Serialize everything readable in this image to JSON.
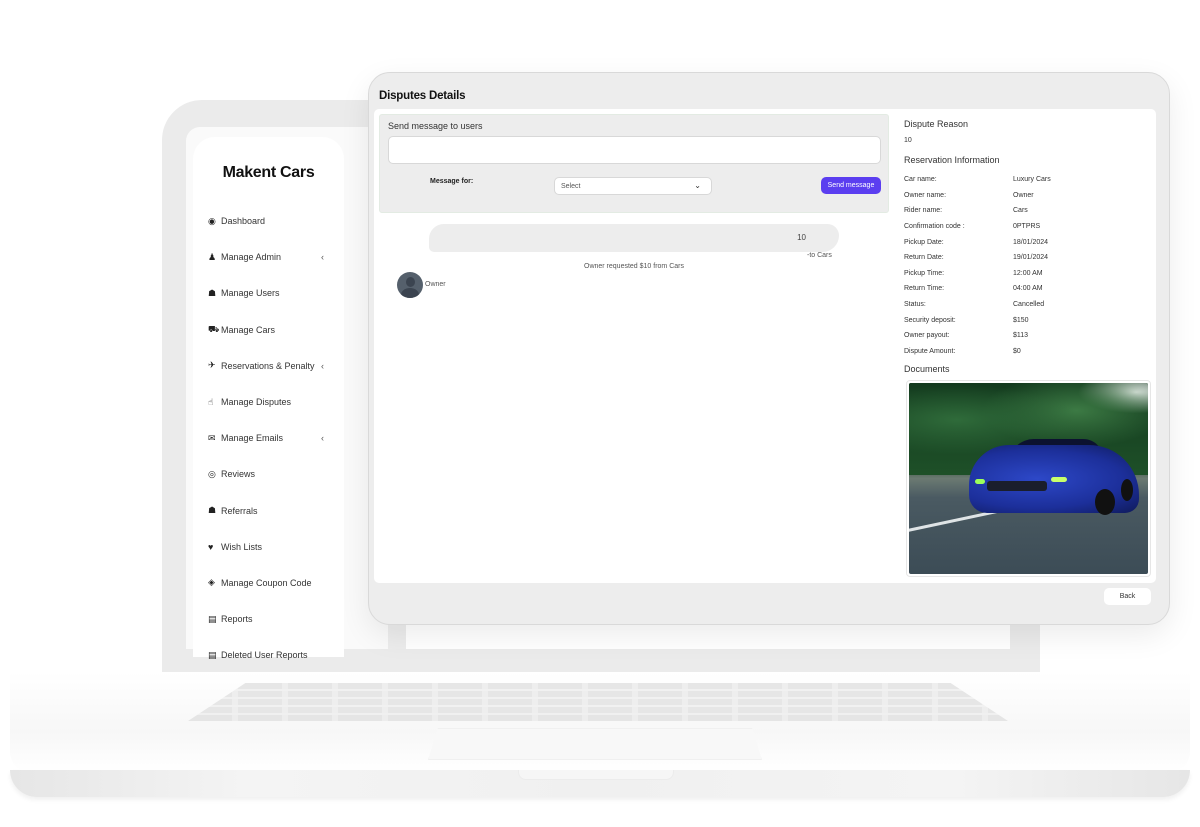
{
  "sidebar": {
    "brand": "Makent Cars",
    "items": [
      {
        "label": "Dashboard",
        "icon": "dashboard-icon",
        "glyph": "◉",
        "has_submenu": false
      },
      {
        "label": "Manage Admin",
        "icon": "user-plus-icon",
        "glyph": "♟",
        "has_submenu": true
      },
      {
        "label": "Manage Users",
        "icon": "users-icon",
        "glyph": "☗",
        "has_submenu": false
      },
      {
        "label": "Manage Cars",
        "icon": "car-icon",
        "glyph": "⛟",
        "has_submenu": false
      },
      {
        "label": "Reservations & Penalty",
        "icon": "plane-icon",
        "glyph": "✈",
        "has_submenu": true
      },
      {
        "label": "Manage Disputes",
        "icon": "hand-pointer-icon",
        "glyph": "☝",
        "has_submenu": false
      },
      {
        "label": "Manage Emails",
        "icon": "envelope-icon",
        "glyph": "✉",
        "has_submenu": true
      },
      {
        "label": "Reviews",
        "icon": "eye-icon",
        "glyph": "◎",
        "has_submenu": false
      },
      {
        "label": "Referrals",
        "icon": "users-icon",
        "glyph": "☗",
        "has_submenu": false
      },
      {
        "label": "Wish Lists",
        "icon": "heart-icon",
        "glyph": "♥",
        "has_submenu": false
      },
      {
        "label": "Manage Coupon Code",
        "icon": "ticket-icon",
        "glyph": "◈",
        "has_submenu": false
      },
      {
        "label": "Reports",
        "icon": "file-icon",
        "glyph": "▤",
        "has_submenu": false
      },
      {
        "label": "Deleted User Reports",
        "icon": "file-icon",
        "glyph": "▤",
        "has_submenu": false
      }
    ],
    "submenu_glyph": "‹"
  },
  "page": {
    "title": "Disputes Details"
  },
  "message_form": {
    "title": "Send message to users",
    "textarea_value": "",
    "message_for_label": "Message for:",
    "select_value": "Select",
    "send_label": "Send message",
    "accent_color": "#5b3ef0"
  },
  "conversation": {
    "bubble_text": "10",
    "bubble_recipient": "-to Cars",
    "request_note": "Owner requested $10 from Cars",
    "sender_name": "Owner"
  },
  "dispute": {
    "reason_title": "Dispute Reason",
    "reason_value": "10",
    "reservation_title": "Reservation Information",
    "reservation_rows": [
      {
        "label": "Car name:",
        "value": "Luxury Cars"
      },
      {
        "label": "Owner name:",
        "value": "Owner"
      },
      {
        "label": "Rider name:",
        "value": "Cars"
      },
      {
        "label": "Confirmation code :",
        "value": "0PTPRS"
      },
      {
        "label": "Pickup Date:",
        "value": "18/01/2024"
      },
      {
        "label": "Return Date:",
        "value": "19/01/2024"
      },
      {
        "label": "Pickup Time:",
        "value": "12:00 AM"
      },
      {
        "label": "Return Time:",
        "value": "04:00 AM"
      },
      {
        "label": "Status:",
        "value": "Cancelled"
      },
      {
        "label": "Security deposit:",
        "value": "$150"
      },
      {
        "label": "Owner payout:",
        "value": "$113"
      },
      {
        "label": "Dispute Amount:",
        "value": "$0"
      }
    ],
    "documents_title": "Documents",
    "document_alt": "Blue sports car on road"
  },
  "actions": {
    "back_label": "Back"
  }
}
